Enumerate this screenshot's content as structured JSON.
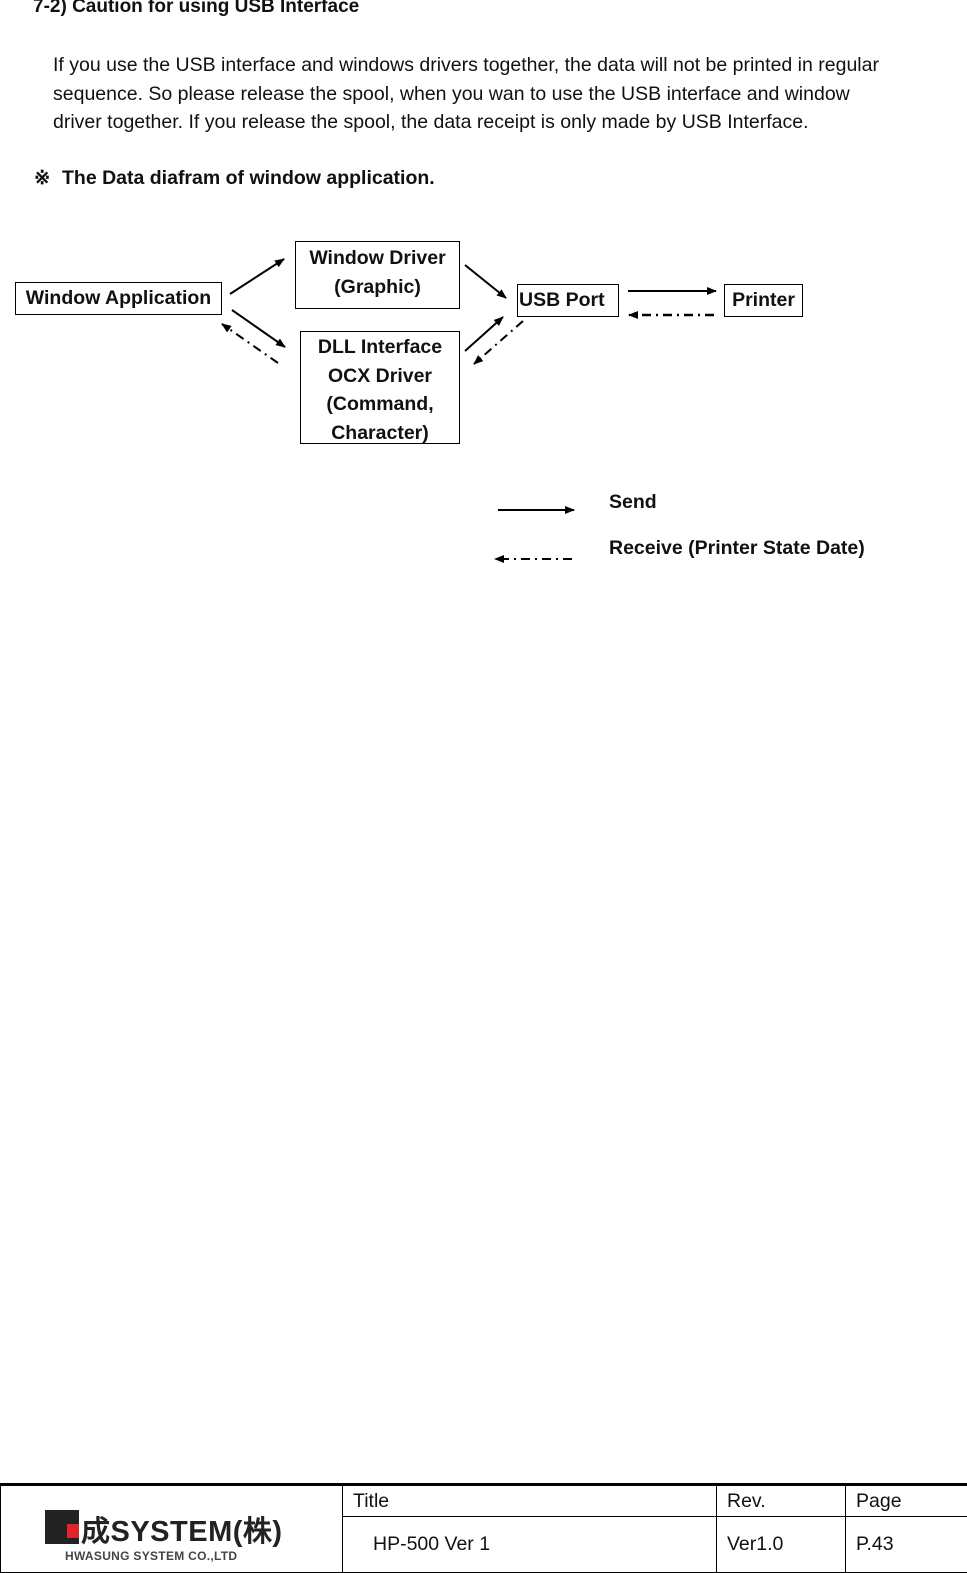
{
  "section": {
    "heading": "7-2) Caution for using USB Interface",
    "paragraph_lines": [
      "If you use the USB interface and windows drivers together, the data will not be printed in regular",
      "sequence. So please release the spool, when you wan to use the USB interface and window",
      "driver together. If you release the spool, the data receipt is only made by USB Interface."
    ],
    "note_mark": "※",
    "note_title": "The Data diafram of window application."
  },
  "diagram": {
    "nodes": {
      "window_application": "Window Application",
      "window_driver": [
        "Window Driver",
        "(Graphic)"
      ],
      "dll_interface": [
        "DLL Interface",
        "OCX Driver",
        "(Command,",
        "Character)"
      ],
      "usb_port": "USB Port",
      "printer": "Printer"
    },
    "legend": {
      "send": "Send",
      "receive": "Receive (Printer State Date)"
    }
  },
  "footer": {
    "logo": {
      "company": "成SYSTEM(株)",
      "company_en": "HWASUNG SYSTEM CO.,LTD",
      "accent_color": "#e0242a"
    },
    "title_label": "Title",
    "title_value": "HP-500 Ver 1",
    "rev_label": "Rev.",
    "rev_value": "Ver1.0",
    "page_label": "Page",
    "page_value": "P.43"
  }
}
